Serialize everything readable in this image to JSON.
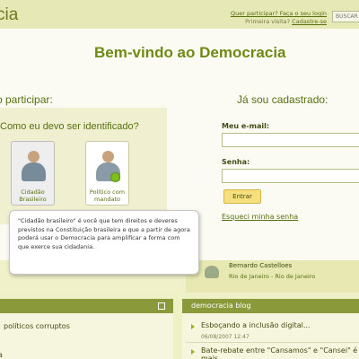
{
  "header": {
    "logo_text": "cia",
    "link_question": "Quer participar? Faça o seu login",
    "first_visit": "Primeira visita?",
    "register_link": "Cadastre-se",
    "search_label": "BUSCAR"
  },
  "welcome": {
    "title": "Bem-vindo ao Democracia",
    "participate_heading": "o participar:",
    "registered_heading": "Já sou cadastrado:",
    "identify_question": "Como eu devo ser identificado?"
  },
  "options": {
    "citizen_label_1": "Cidadão",
    "citizen_label_2": "Brasileiro",
    "politician_label_1": "Político com",
    "politician_label_2": "mandato"
  },
  "login": {
    "email_label": "Meu e-mail:",
    "password_label": "Senha:",
    "enter_button": "Entrar",
    "forgot_link": "Esqueci minha senha"
  },
  "tooltip": {
    "text": "\"Cidadão brasileiro\" é você que tem direitos e deveres previstos na Constituição brasileira e que a partir de agora poderá usar o Democracia para amplificar a forma com que exerce sua cidadania."
  },
  "strip": {
    "name": "Bernardo Castelloes",
    "location": "Rio de Janeiro - Rio de Janeiro"
  },
  "left_panel": {
    "item1": "políticos corruptos",
    "item2": "a"
  },
  "blog": {
    "title": "democracia blog",
    "post1": "Esboçando a inclusão digital...",
    "post1_date": "06/08/2007 12:47",
    "post2": "Bate-rebate entre \"Cansamos\" e \"Cansei\" é mais"
  },
  "colors": {
    "accent_green": "#6e8a14",
    "header_bg": "#e6e8b6",
    "button_yellow": "#f6df7d"
  }
}
